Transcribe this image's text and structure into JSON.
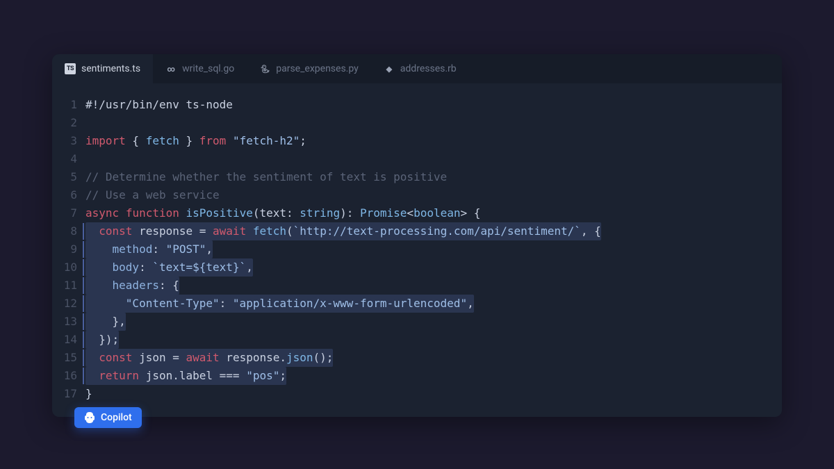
{
  "tabs": [
    {
      "label": "sentiments.ts",
      "icon": "ts",
      "active": true
    },
    {
      "label": "write_sql.go",
      "icon": "go",
      "active": false
    },
    {
      "label": "parse_expenses.py",
      "icon": "python",
      "active": false
    },
    {
      "label": "addresses.rb",
      "icon": "ruby",
      "active": false
    }
  ],
  "copilot": {
    "label": "Copilot"
  },
  "line_count": 17,
  "highlighted_lines": [
    8,
    9,
    10,
    11,
    12,
    13,
    14,
    15,
    16
  ],
  "code_lines": [
    [
      {
        "t": "#!/usr/bin/env ts-node",
        "c": "default"
      }
    ],
    [],
    [
      {
        "t": "import",
        "c": "kw"
      },
      {
        "t": " { ",
        "c": "punc"
      },
      {
        "t": "fetch",
        "c": "fn"
      },
      {
        "t": " } ",
        "c": "punc"
      },
      {
        "t": "from",
        "c": "kw"
      },
      {
        "t": " ",
        "c": "punc"
      },
      {
        "t": "\"fetch-h2\"",
        "c": "str"
      },
      {
        "t": ";",
        "c": "punc"
      }
    ],
    [],
    [
      {
        "t": "// Determine whether the sentiment of text is positive",
        "c": "comment"
      }
    ],
    [
      {
        "t": "// Use a web service",
        "c": "comment"
      }
    ],
    [
      {
        "t": "async",
        "c": "kw"
      },
      {
        "t": " ",
        "c": "punc"
      },
      {
        "t": "function",
        "c": "kw"
      },
      {
        "t": " ",
        "c": "punc"
      },
      {
        "t": "isPositive",
        "c": "fn"
      },
      {
        "t": "(text: ",
        "c": "punc"
      },
      {
        "t": "string",
        "c": "type"
      },
      {
        "t": "): ",
        "c": "punc"
      },
      {
        "t": "Promise",
        "c": "type"
      },
      {
        "t": "<",
        "c": "punc"
      },
      {
        "t": "boolean",
        "c": "type"
      },
      {
        "t": "> {",
        "c": "punc"
      }
    ],
    [
      {
        "t": "  ",
        "c": "punc"
      },
      {
        "t": "const",
        "c": "kw"
      },
      {
        "t": " response = ",
        "c": "punc"
      },
      {
        "t": "await",
        "c": "kw"
      },
      {
        "t": " ",
        "c": "punc"
      },
      {
        "t": "fetch",
        "c": "fn"
      },
      {
        "t": "(",
        "c": "punc"
      },
      {
        "t": "`http://text-processing.com/api/sentiment/`",
        "c": "str"
      },
      {
        "t": ", {",
        "c": "punc"
      }
    ],
    [
      {
        "t": "    ",
        "c": "punc"
      },
      {
        "t": "method",
        "c": "prop"
      },
      {
        "t": ": ",
        "c": "punc"
      },
      {
        "t": "\"POST\"",
        "c": "str"
      },
      {
        "t": ",",
        "c": "punc"
      }
    ],
    [
      {
        "t": "    ",
        "c": "punc"
      },
      {
        "t": "body",
        "c": "prop"
      },
      {
        "t": ": ",
        "c": "punc"
      },
      {
        "t": "`text=${text}`",
        "c": "str"
      },
      {
        "t": ",",
        "c": "punc"
      }
    ],
    [
      {
        "t": "    ",
        "c": "punc"
      },
      {
        "t": "headers",
        "c": "prop"
      },
      {
        "t": ": {",
        "c": "punc"
      }
    ],
    [
      {
        "t": "      ",
        "c": "punc"
      },
      {
        "t": "\"Content-Type\"",
        "c": "str"
      },
      {
        "t": ": ",
        "c": "punc"
      },
      {
        "t": "\"application/x-www-form-urlencoded\"",
        "c": "str"
      },
      {
        "t": ",",
        "c": "punc"
      }
    ],
    [
      {
        "t": "    },",
        "c": "punc"
      }
    ],
    [
      {
        "t": "  });",
        "c": "punc"
      }
    ],
    [
      {
        "t": "  ",
        "c": "punc"
      },
      {
        "t": "const",
        "c": "kw"
      },
      {
        "t": " json = ",
        "c": "punc"
      },
      {
        "t": "await",
        "c": "kw"
      },
      {
        "t": " response.",
        "c": "punc"
      },
      {
        "t": "json",
        "c": "fn"
      },
      {
        "t": "();",
        "c": "punc"
      }
    ],
    [
      {
        "t": "  ",
        "c": "punc"
      },
      {
        "t": "return",
        "c": "kw"
      },
      {
        "t": " json.label === ",
        "c": "punc"
      },
      {
        "t": "\"pos\"",
        "c": "str"
      },
      {
        "t": ";",
        "c": "punc"
      }
    ],
    [
      {
        "t": "}",
        "c": "punc"
      }
    ]
  ]
}
